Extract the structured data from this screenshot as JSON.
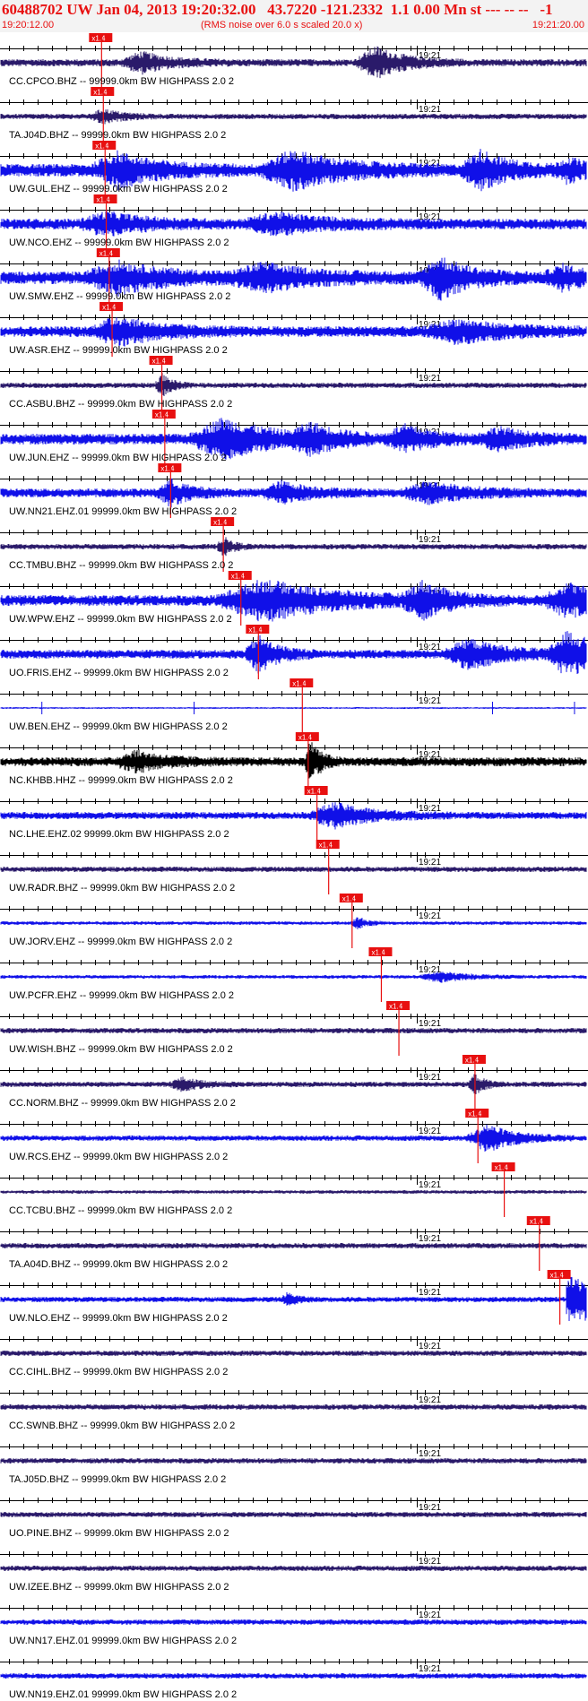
{
  "header": {
    "title": "60488702 UW Jan 04, 2013 19:20:32.00   43.7220 -121.2332  1.1 0.00 Mn st --- -- --   -1",
    "start_time": "19:20:12.00",
    "note": "(RMS noise over 6.0 s scaled 20.0 x)",
    "end_time": "19:21:20.00"
  },
  "colors": {
    "header_text": "#e81010",
    "pick": "#e81010",
    "pick_box": "#e81010",
    "ticks": "#000000"
  },
  "chart_data": {
    "type": "line",
    "title": "60488702 UW Jan 04, 2013 19:20:32.00",
    "x_range": [
      "19:20:12.00",
      "19:21:20.00"
    ],
    "minute_marker": "19:21",
    "pick_label": "x1.4",
    "traces": [
      {
        "label": "CC.CPCO.BHZ -- 99999.0km BW  HIGHPASS  2.0  2",
        "color": "#2a1a6a",
        "pick": 0.172,
        "amp": 4,
        "bursts": [
          [
            0.24,
            10,
            0.03
          ],
          [
            0.64,
            16,
            0.03
          ]
        ],
        "clip": false
      },
      {
        "label": "TA.J04D.BHZ -- 99999.0km BW  HIGHPASS  2.0  2",
        "color": "#2a1a6a",
        "pick": 0.175,
        "amp": 3,
        "bursts": [
          [
            0.175,
            7,
            0.02
          ]
        ],
        "clip": false
      },
      {
        "label": "UW.GUL.EHZ -- 99999.0km BW  HIGHPASS  2.0  2",
        "color": "#1010e8",
        "pick": 0.178,
        "amp": 7,
        "bursts": [
          [
            0.2,
            16,
            0.04
          ],
          [
            0.5,
            18,
            0.05
          ],
          [
            0.82,
            18,
            0.03
          ],
          [
            0.97,
            10,
            0.02
          ]
        ],
        "clip": false
      },
      {
        "label": "UW.NCO.EHZ -- 99999.0km BW  HIGHPASS  2.0  2",
        "color": "#1010e8",
        "pick": 0.18,
        "amp": 6,
        "bursts": [
          [
            0.18,
            10,
            0.04
          ],
          [
            0.47,
            9,
            0.05
          ]
        ],
        "clip": false
      },
      {
        "label": "UW.SMW.EHZ -- 99999.0km BW  HIGHPASS  2.0  2",
        "color": "#1010e8",
        "pick": 0.185,
        "amp": 7,
        "bursts": [
          [
            0.2,
            14,
            0.05
          ],
          [
            0.45,
            12,
            0.05
          ],
          [
            0.75,
            20,
            0.03
          ],
          [
            0.96,
            10,
            0.03
          ]
        ],
        "clip": false
      },
      {
        "label": "UW.ASR.EHZ -- 99999.0km BW  HIGHPASS  2.0  2",
        "color": "#1010e8",
        "pick": 0.19,
        "amp": 6,
        "bursts": [
          [
            0.2,
            14,
            0.04
          ],
          [
            0.78,
            10,
            0.05
          ]
        ],
        "clip": false
      },
      {
        "label": "CC.ASBU.BHZ -- 99999.0km BW  HIGHPASS  2.0  2",
        "color": "#2a1a6a",
        "pick": 0.275,
        "amp": 3,
        "bursts": [
          [
            0.275,
            12,
            0.01
          ]
        ],
        "clip": false
      },
      {
        "label": "UW.JUN.EHZ -- 99999.0km BW  HIGHPASS  2.0  2",
        "color": "#1010e8",
        "pick": 0.28,
        "amp": 6,
        "bursts": [
          [
            0.38,
            20,
            0.05
          ],
          [
            0.53,
            12,
            0.03
          ],
          [
            0.69,
            12,
            0.03
          ],
          [
            0.85,
            10,
            0.03
          ]
        ],
        "clip": false
      },
      {
        "label": "UW.NN21.EHZ.01 99999.0km BW  HIGHPASS  2.0  2",
        "color": "#1010e8",
        "pick": 0.29,
        "amp": 5,
        "bursts": [
          [
            0.29,
            12,
            0.02
          ],
          [
            0.48,
            10,
            0.03
          ],
          [
            0.73,
            10,
            0.04
          ]
        ],
        "clip": false
      },
      {
        "label": "CC.TMBU.BHZ -- 99999.0km BW  HIGHPASS  2.0  2",
        "color": "#2a1a6a",
        "pick": 0.38,
        "amp": 3,
        "bursts": [
          [
            0.38,
            10,
            0.01
          ]
        ],
        "clip": false
      },
      {
        "label": "UW.WPW.EHZ -- 99999.0km BW  HIGHPASS  2.0  2",
        "color": "#1010e8",
        "pick": 0.41,
        "amp": 6,
        "bursts": [
          [
            0.45,
            20,
            0.07
          ],
          [
            0.72,
            16,
            0.03
          ],
          [
            0.97,
            16,
            0.04
          ]
        ],
        "clip": false
      },
      {
        "label": "UO.FRIS.EHZ -- 99999.0km BW  HIGHPASS  2.0  2",
        "color": "#1010e8",
        "pick": 0.44,
        "amp": 5,
        "bursts": [
          [
            0.44,
            18,
            0.02
          ],
          [
            0.8,
            14,
            0.04
          ],
          [
            0.97,
            24,
            0.03
          ]
        ],
        "clip": false
      },
      {
        "label": "UW.BEN.EHZ -- 99999.0km BW  HIGHPASS  2.0  2",
        "color": "#1010e8",
        "pick": 0.515,
        "amp": 1,
        "bursts": [],
        "clip": false
      },
      {
        "label": "NC.KHBB.HHZ -- 99999.0km BW  HIGHPASS  2.0  2",
        "color": "#000000",
        "pick": 0.525,
        "amp": 5,
        "bursts": [
          [
            0.23,
            10,
            0.03
          ],
          [
            0.53,
            22,
            0.01
          ]
        ],
        "clip": false
      },
      {
        "label": "NC.LHE.EHZ.02 99999.0km BW  HIGHPASS  2.0  2",
        "color": "#1010e8",
        "pick": 0.54,
        "amp": 4,
        "bursts": [
          [
            0.57,
            12,
            0.04
          ]
        ],
        "clip": false
      },
      {
        "label": "UW.RADR.BHZ -- 99999.0km BW  HIGHPASS  2.0  2",
        "color": "#2a1a6a",
        "pick": 0.56,
        "amp": 3,
        "bursts": [],
        "clip": false
      },
      {
        "label": "UW.JORV.EHZ -- 99999.0km BW  HIGHPASS  2.0  2",
        "color": "#1010e8",
        "pick": 0.6,
        "amp": 2,
        "bursts": [
          [
            0.61,
            6,
            0.01
          ]
        ],
        "clip": false
      },
      {
        "label": "UW.PCFR.EHZ -- 99999.0km BW  HIGHPASS  2.0  2",
        "color": "#1010e8",
        "pick": 0.65,
        "amp": 2,
        "bursts": [
          [
            0.75,
            5,
            0.03
          ]
        ],
        "clip": false
      },
      {
        "label": "UW.WISH.BHZ -- 99999.0km BW  HIGHPASS  2.0  2",
        "color": "#2a1a6a",
        "pick": 0.68,
        "amp": 3,
        "bursts": [],
        "clip": false
      },
      {
        "label": "CC.NORM.BHZ -- 99999.0km BW  HIGHPASS  2.0  2",
        "color": "#2a1a6a",
        "pick": 0.81,
        "amp": 3,
        "bursts": [
          [
            0.31,
            6,
            0.02
          ],
          [
            0.81,
            10,
            0.01
          ]
        ],
        "clip": false
      },
      {
        "label": "UW.RCS.EHZ -- 99999.0km BW  HIGHPASS  2.0  2",
        "color": "#1010e8",
        "pick": 0.815,
        "amp": 3,
        "bursts": [
          [
            0.83,
            14,
            0.03
          ]
        ],
        "clip": false
      },
      {
        "label": "CC.TCBU.BHZ -- 99999.0km BW  HIGHPASS  2.0  2",
        "color": "#2a1a6a",
        "pick": 0.86,
        "amp": 2,
        "bursts": [],
        "clip": false
      },
      {
        "label": "TA.A04D.BHZ -- 99999.0km BW  HIGHPASS  2.0  2",
        "color": "#2a1a6a",
        "pick": 0.92,
        "amp": 3,
        "bursts": [],
        "clip": false
      },
      {
        "label": "UW.NLO.EHZ -- 99999.0km BW  HIGHPASS  2.0  2",
        "color": "#1010e8",
        "pick": 0.955,
        "amp": 3,
        "bursts": [
          [
            0.49,
            6,
            0.01
          ]
        ],
        "clip": true
      },
      {
        "label": "CC.CIHL.BHZ -- 99999.0km BW  HIGHPASS  2.0  2",
        "color": "#2a1a6a",
        "pick": null,
        "amp": 3,
        "bursts": [],
        "clip": false
      },
      {
        "label": "CC.SWNB.BHZ -- 99999.0km BW  HIGHPASS  2.0  2",
        "color": "#2a1a6a",
        "pick": null,
        "amp": 3,
        "bursts": [],
        "clip": false
      },
      {
        "label": "TA.J05D.BHZ -- 99999.0km BW  HIGHPASS  2.0  2",
        "color": "#2a1a6a",
        "pick": null,
        "amp": 3,
        "bursts": [],
        "clip": false
      },
      {
        "label": "UO.PINE.BHZ -- 99999.0km BW  HIGHPASS  2.0  2",
        "color": "#2a1a6a",
        "pick": null,
        "amp": 3,
        "bursts": [],
        "clip": false
      },
      {
        "label": "UW.IZEE.BHZ -- 99999.0km BW  HIGHPASS  2.0  2",
        "color": "#2a1a6a",
        "pick": null,
        "amp": 3,
        "bursts": [],
        "clip": false
      },
      {
        "label": "UW.NN17.EHZ.01 99999.0km BW  HIGHPASS  2.0  2",
        "color": "#1010e8",
        "pick": null,
        "amp": 3,
        "bursts": [],
        "clip": false
      },
      {
        "label": "UW.NN19.EHZ.01 99999.0km BW  HIGHPASS  2.0  2",
        "color": "#1010e8",
        "pick": null,
        "amp": 3,
        "bursts": [],
        "clip": false
      }
    ]
  }
}
